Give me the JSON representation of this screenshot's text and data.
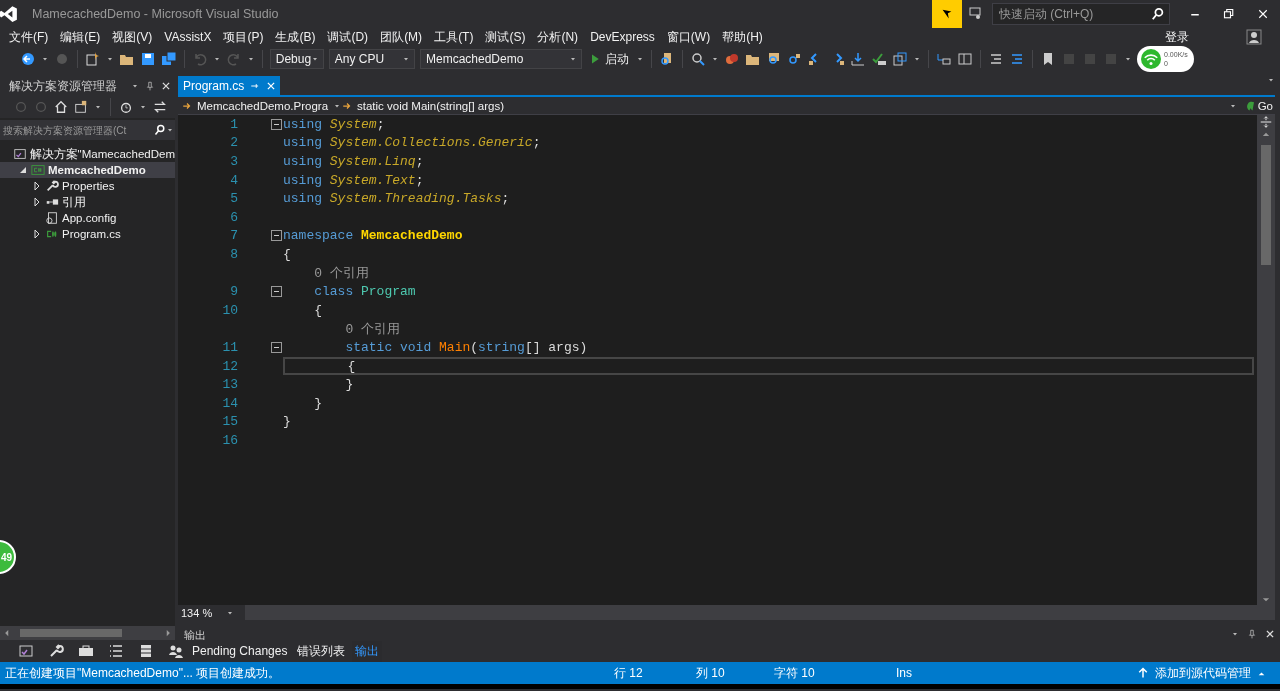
{
  "window": {
    "title": "MamecachedDemo - Microsoft Visual Studio",
    "quick_launch_placeholder": "快速启动 (Ctrl+Q)"
  },
  "menu": [
    "文件(F)",
    "编辑(E)",
    "视图(V)",
    "VAssistX",
    "项目(P)",
    "生成(B)",
    "调试(D)",
    "团队(M)",
    "工具(T)",
    "测试(S)",
    "分析(N)",
    "DevExpress",
    "窗口(W)",
    "帮助(H)"
  ],
  "sign_in": "登录",
  "toolbar": {
    "configuration": "Debug",
    "platform": "Any CPU",
    "startup_project": "MemcachedDemo",
    "start_label": "启动"
  },
  "network_widget": {
    "speed": "0.00K/s",
    "count": "0"
  },
  "solution_explorer": {
    "title": "解决方案资源管理器",
    "search_placeholder": "搜索解决方案资源管理器(Ct",
    "tree": [
      {
        "label": "解决方案\"MamecachedDem",
        "kind": "solution",
        "selected": false,
        "children": [
          {
            "label": "MemcachedDemo",
            "kind": "project",
            "expanded": true,
            "selected": true,
            "children": [
              {
                "label": "Properties",
                "kind": "properties",
                "expanded": false,
                "selected": false
              },
              {
                "label": "引用",
                "kind": "references",
                "expanded": false,
                "selected": false
              },
              {
                "label": "App.config",
                "kind": "config",
                "selected": false
              },
              {
                "label": "Program.cs",
                "kind": "csharp",
                "expanded": false,
                "selected": false
              }
            ]
          }
        ]
      }
    ]
  },
  "editor": {
    "tabs": [
      {
        "label": "Program.cs",
        "selected": true
      }
    ],
    "nav_type": "MemcachedDemo.Progra",
    "nav_member": "static void Main(string[] args)",
    "go_label": "Go",
    "zoom": "134 %",
    "lines": [
      {
        "kind": "code",
        "number": "1",
        "fold": true,
        "current": false,
        "tokens": [
          {
            "text": "using",
            "kind": "keyword"
          },
          {
            "text": " System",
            "kind": "namespace"
          },
          {
            "text": ";",
            "kind": "punct"
          }
        ]
      },
      {
        "kind": "code",
        "number": "2",
        "fold": false,
        "current": false,
        "tokens": [
          {
            "text": "using",
            "kind": "keyword"
          },
          {
            "text": " System.Collections.Generic",
            "kind": "namespace"
          },
          {
            "text": ";",
            "kind": "punct"
          }
        ]
      },
      {
        "kind": "code",
        "number": "3",
        "fold": false,
        "current": false,
        "tokens": [
          {
            "text": "using",
            "kind": "keyword"
          },
          {
            "text": " System.Linq",
            "kind": "namespace"
          },
          {
            "text": ";",
            "kind": "punct"
          }
        ]
      },
      {
        "kind": "code",
        "number": "4",
        "fold": false,
        "current": false,
        "tokens": [
          {
            "text": "using",
            "kind": "keyword"
          },
          {
            "text": " System.Text",
            "kind": "namespace"
          },
          {
            "text": ";",
            "kind": "punct"
          }
        ]
      },
      {
        "kind": "code",
        "number": "5",
        "fold": false,
        "current": false,
        "tokens": [
          {
            "text": "using",
            "kind": "keyword"
          },
          {
            "text": " System.Threading.Tasks",
            "kind": "namespace"
          },
          {
            "text": ";",
            "kind": "punct"
          }
        ]
      },
      {
        "kind": "code",
        "number": "6",
        "fold": false,
        "current": false
      },
      {
        "kind": "code",
        "number": "7",
        "fold": true,
        "current": false,
        "tokens": [
          {
            "text": "namespace",
            "kind": "keyword"
          },
          {
            "text": " MemcachedDemo",
            "kind": "name"
          }
        ]
      },
      {
        "kind": "code",
        "number": "8",
        "fold": false,
        "current": false,
        "tokens": [
          {
            "text": "{",
            "kind": "plain"
          }
        ]
      },
      {
        "kind": "lens",
        "text": "    0 个引用"
      },
      {
        "kind": "code",
        "number": "9",
        "fold": true,
        "current": false,
        "tokens": [
          {
            "text": "    class",
            "kind": "keyword"
          },
          {
            "text": " Program",
            "kind": "type"
          }
        ]
      },
      {
        "kind": "code",
        "number": "10",
        "fold": false,
        "current": false,
        "tokens": [
          {
            "text": "    {",
            "kind": "plain"
          }
        ]
      },
      {
        "kind": "lens",
        "text": "        0 个引用"
      },
      {
        "kind": "code",
        "number": "11",
        "fold": true,
        "current": false,
        "tokens": [
          {
            "text": "        static void",
            "kind": "keyword"
          },
          {
            "text": " Main",
            "kind": "method"
          },
          {
            "text": "(",
            "kind": "plain"
          },
          {
            "text": "string",
            "kind": "keyword"
          },
          {
            "text": "[] args)",
            "kind": "plain"
          }
        ]
      },
      {
        "kind": "code",
        "number": "12",
        "fold": false,
        "current": true,
        "tokens": [
          {
            "text": "        {",
            "kind": "plain"
          }
        ]
      },
      {
        "kind": "code",
        "number": "13",
        "fold": false,
        "current": false,
        "tokens": [
          {
            "text": "        }",
            "kind": "plain"
          }
        ]
      },
      {
        "kind": "code",
        "number": "14",
        "fold": false,
        "current": false,
        "tokens": [
          {
            "text": "    }",
            "kind": "plain"
          }
        ]
      },
      {
        "kind": "code",
        "number": "15",
        "fold": false,
        "current": false,
        "tokens": [
          {
            "text": "}",
            "kind": "plain"
          }
        ]
      },
      {
        "kind": "code",
        "number": "16",
        "fold": false,
        "current": false
      }
    ]
  },
  "output_panel": {
    "title": "输出"
  },
  "bottom_tabs": [
    {
      "label": "Pending Changes",
      "selected": false
    },
    {
      "label": "错误列表",
      "selected": false
    },
    {
      "label": "输出",
      "selected": true
    }
  ],
  "status_bar": {
    "message": "正在创建项目\"MemcachedDemo\"... 项目创建成功。",
    "line": "行 12",
    "column": "列 10",
    "char": "字符 10",
    "mode": "Ins",
    "source_control": "添加到源代码管理"
  },
  "float_badge": "49"
}
